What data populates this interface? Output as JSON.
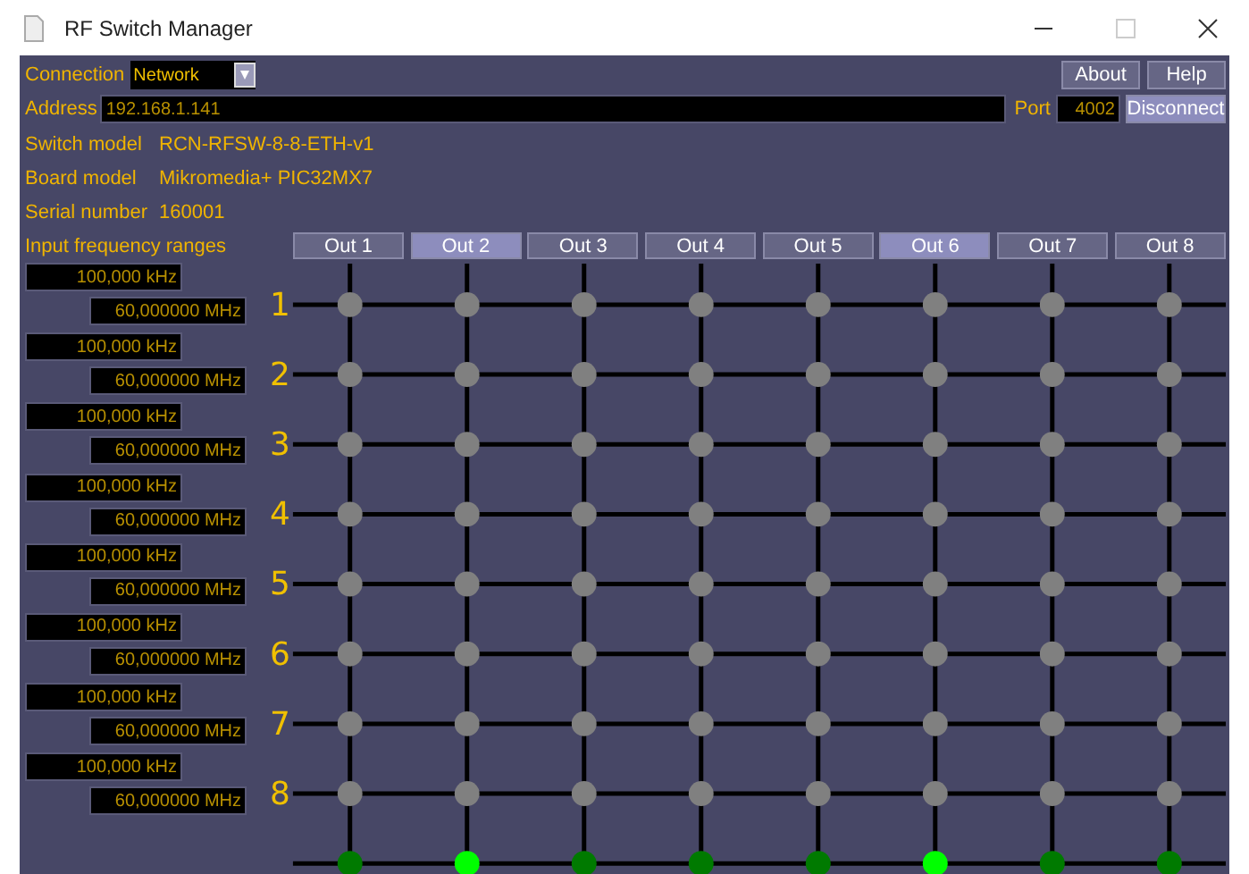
{
  "window": {
    "title": "RF Switch Manager"
  },
  "connection": {
    "label": "Connection",
    "value": "Network"
  },
  "buttons": {
    "about": "About",
    "help": "Help",
    "disconnect": "Disconnect"
  },
  "address": {
    "label": "Address",
    "value": "192.168.1.141"
  },
  "port": {
    "label": "Port",
    "value": "4002"
  },
  "info": [
    {
      "label": "Switch model",
      "value": "RCN-RFSW-8-8-ETH-v1"
    },
    {
      "label": "Board model",
      "value": "Mikromedia+ PIC32MX7"
    },
    {
      "label": "Serial number",
      "value": "160001"
    }
  ],
  "inputs_title": "Input frequency ranges",
  "outputs": [
    {
      "label": "Out 1",
      "selected": false,
      "active": false
    },
    {
      "label": "Out 2",
      "selected": true,
      "active": true
    },
    {
      "label": "Out 3",
      "selected": false,
      "active": false
    },
    {
      "label": "Out 4",
      "selected": false,
      "active": false
    },
    {
      "label": "Out 5",
      "selected": false,
      "active": false
    },
    {
      "label": "Out 6",
      "selected": true,
      "active": true
    },
    {
      "label": "Out 7",
      "selected": false,
      "active": false
    },
    {
      "label": "Out 8",
      "selected": false,
      "active": false
    }
  ],
  "inputs": [
    {
      "number": "1",
      "low": "100,000 kHz",
      "high": "60,000000 MHz"
    },
    {
      "number": "2",
      "low": "100,000 kHz",
      "high": "60,000000 MHz"
    },
    {
      "number": "3",
      "low": "100,000 kHz",
      "high": "60,000000 MHz"
    },
    {
      "number": "4",
      "low": "100,000 kHz",
      "high": "60,000000 MHz"
    },
    {
      "number": "5",
      "low": "100,000 kHz",
      "high": "60,000000 MHz"
    },
    {
      "number": "6",
      "low": "100,000 kHz",
      "high": "60,000000 MHz"
    },
    {
      "number": "7",
      "low": "100,000 kHz",
      "high": "60,000000 MHz"
    },
    {
      "number": "8",
      "low": "100,000 kHz",
      "high": "60,000000 MHz"
    }
  ]
}
